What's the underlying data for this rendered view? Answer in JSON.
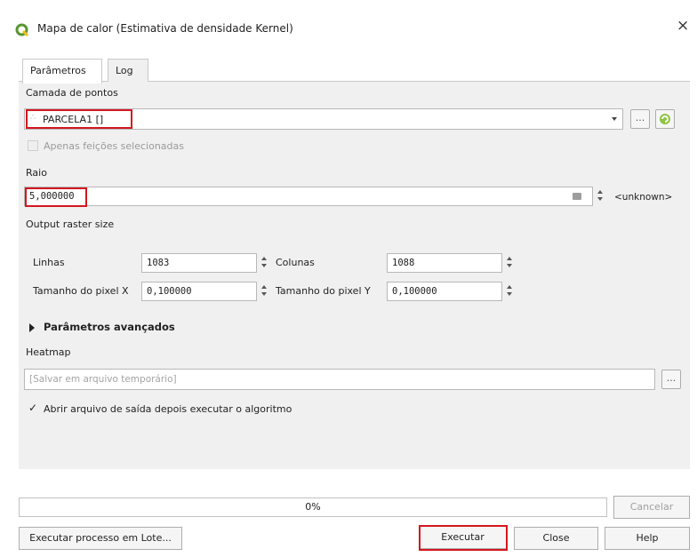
{
  "window": {
    "title": "Mapa de calor (Estimativa de densidade Kernel)",
    "close_glyph": "×"
  },
  "tabs": [
    {
      "label": "Parâmetros",
      "active": true
    },
    {
      "label": "Log",
      "active": false
    }
  ],
  "form": {
    "point_layer": {
      "label": "Camada de pontos",
      "value": "PARCELA1 []",
      "selected_only_label": "Apenas feições selecionadas",
      "ellipsis_label": "..."
    },
    "radius": {
      "label": "Raio",
      "value": "5,000000",
      "unit": "<unknown>"
    },
    "output_raster_size": {
      "label": "Output raster size",
      "rows_label": "Linhas",
      "rows_value": "1083",
      "cols_label": "Colunas",
      "cols_value": "1088",
      "pixel_x_label": "Tamanho do pixel X",
      "pixel_x_value": "0,100000",
      "pixel_y_label": "Tamanho do pixel Y",
      "pixel_y_value": "0,100000"
    },
    "advanced_label": "Parâmetros avançados",
    "heatmap": {
      "label": "Heatmap",
      "placeholder": "[Salvar em arquivo temporário]",
      "ellipsis_label": "...",
      "open_after_label": "Abrir arquivo de saída depois executar o algoritmo"
    }
  },
  "progress": {
    "text": "0%",
    "value": 0
  },
  "buttons": {
    "cancel": "Cancelar",
    "batch": "Executar processo em Lote...",
    "run": "Executar",
    "close": "Close",
    "help": "Help"
  },
  "colors": {
    "highlight": "#d4161e",
    "qgis_green": "#589632"
  }
}
